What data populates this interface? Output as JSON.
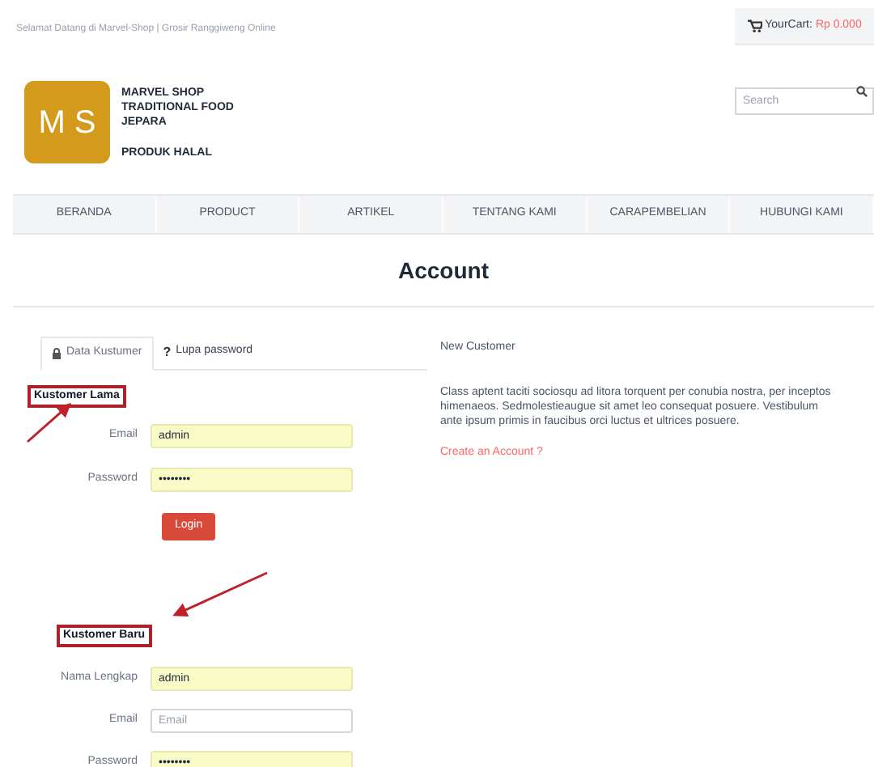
{
  "top_bar": {
    "welcome": "Selamat Datang di Marvel-Shop | Grosir Ranggiweng Online",
    "cart_label": "YourCart:",
    "cart_amount": "Rp 0.000"
  },
  "logo": {
    "letters": "M S",
    "lines": [
      "MARVEL SHOP",
      "TRADITIONAL FOOD",
      "JEPARA"
    ],
    "tagline": "PRODUK HALAL"
  },
  "search": {
    "placeholder": "Search"
  },
  "nav": [
    "BERANDA",
    "PRODUCT",
    "ARTIKEL",
    "TENTANG KAMI",
    "CARAPEMBELIAN",
    "HUBUNGI KAMI"
  ],
  "page_title": "Account",
  "tabs": [
    {
      "label": "Data Kustumer",
      "selected": true
    },
    {
      "label": "Lupa password",
      "symbol": "?",
      "selected": false
    }
  ],
  "login": {
    "heading": "Kustomer Lama",
    "fields": [
      {
        "label": "Email",
        "value": "admin",
        "autofilled": true
      },
      {
        "label": "Password",
        "value": "••••••••",
        "autofilled": true
      }
    ],
    "button": "Login"
  },
  "register": {
    "heading": "Kustomer Baru",
    "fields": [
      {
        "label": "Nama Lengkap",
        "value": "admin",
        "autofilled": true
      },
      {
        "label": "Email",
        "placeholder": "Email",
        "autofilled": false
      },
      {
        "label": "Password",
        "value": "••••••••",
        "autofilled": true
      }
    ]
  },
  "new_customer": {
    "title": "New Customer",
    "text": "Class aptent taciti sociosqu ad litora torquent per conubia nostra, per inceptos himenaeos. Sedmolestieaugue sit amet leo consequat posuere. Vestibulum ante ipsum primis in faucibus orci luctus et ultrices posuere.",
    "link": "Create an Account ?"
  }
}
